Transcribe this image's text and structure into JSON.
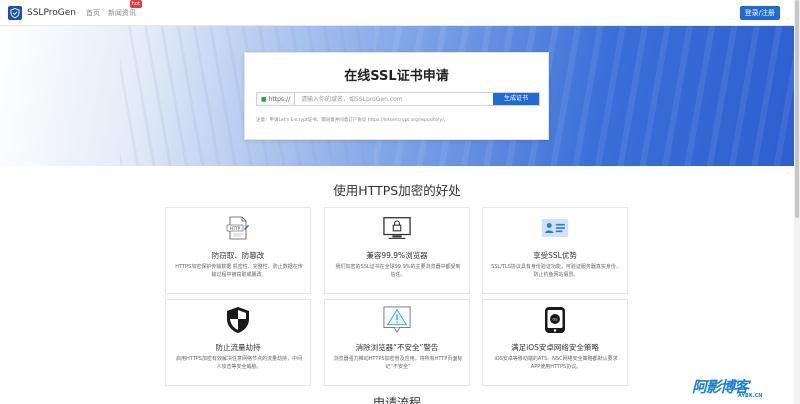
{
  "navbar": {
    "brand": "SSLProGen",
    "links": [
      {
        "label": "首页"
      },
      {
        "label": "新闻资讯",
        "badge": "hot"
      }
    ],
    "login_label": "登录/注册"
  },
  "hero": {
    "title": "在线SSL证书申请",
    "prefix": "https://",
    "input_placeholder": "请输入你的域名，如SSLproGen.com",
    "input_value": "",
    "generate_label": "生成证书",
    "note": "注意：申请Let's Encrypt证书，需同意并同意订户协议 https://letsencrypt.org/repository/。"
  },
  "benefits": {
    "title": "使用HTTPS加密的好处",
    "items": [
      {
        "icon": "http-document-icon",
        "title": "防窃取、防篡改",
        "desc": "HTTPS加密保护传输数据 机密性、完整性、防止数据在传输过程中被窃取或篡改。"
      },
      {
        "icon": "lock-monitor-icon",
        "title": "兼容99.9%浏览器",
        "desc": "我们加密的SSL证书在全球99.9%的主要浏览器中都受到信任。"
      },
      {
        "icon": "id-card-icon",
        "title": "享受SSL优势",
        "desc": "SSL/TLS协议具有身份验证功能，可验证服务器真实身份，防止钓鱼网站假冒。"
      },
      {
        "icon": "shield-icon",
        "title": "防止流量劫持",
        "desc": "启用HTTPS加密有效解决任意网络节点的流量劫持，中间人攻击等安全威胁。"
      },
      {
        "icon": "warning-icon",
        "title": "消除浏览器“不安全”警告",
        "desc": "浏览器强力推动HTTPS加密普及应用，将所有HTTP页面标记“不安全”"
      },
      {
        "icon": "ios-phone-icon",
        "title": "满足iOS安卓网络安全策略",
        "desc": "iOS安卓等移动端的ATS、NSC网络安全策略都默认要求APP使用HTTPS协议。"
      }
    ]
  },
  "next_section": {
    "title": "申请流程"
  },
  "watermark": {
    "main": "阿影博客",
    "sub": "AYBK.CN"
  },
  "colors": {
    "primary": "#1f6bd6",
    "hot": "#e03e3e",
    "lock": "#2aa24a"
  }
}
